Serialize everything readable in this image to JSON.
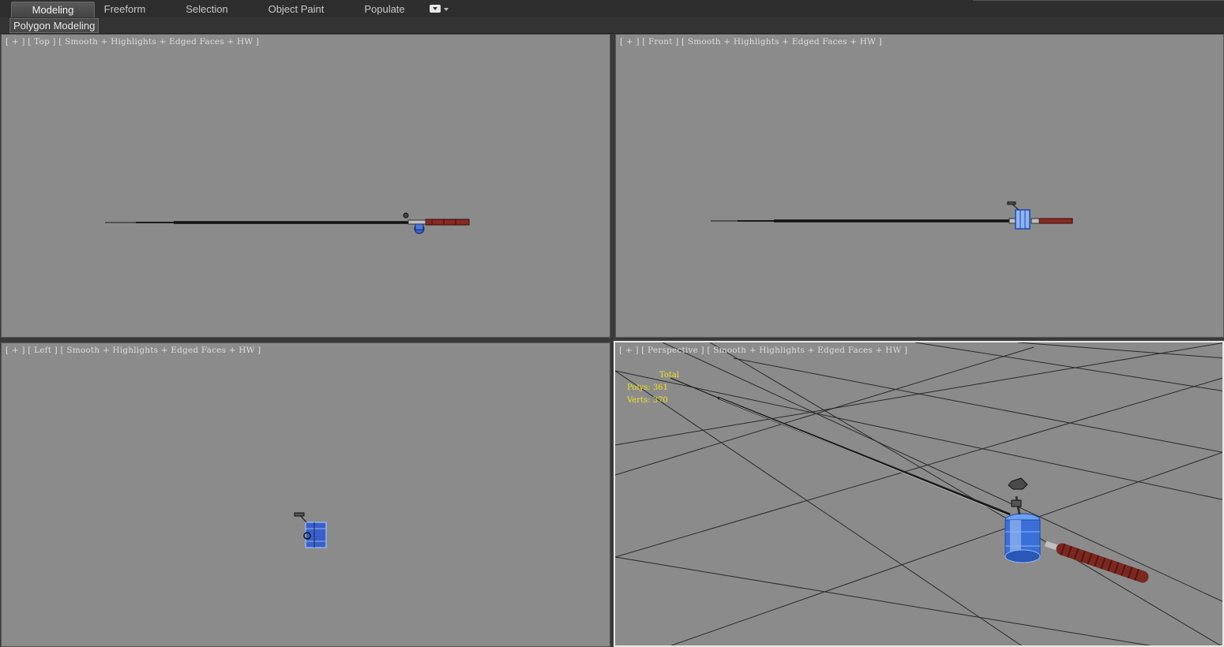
{
  "ribbon": {
    "tabs": [
      {
        "label": "Modeling"
      },
      {
        "label": "Freeform"
      },
      {
        "label": "Selection"
      },
      {
        "label": "Object Paint"
      },
      {
        "label": "Populate"
      }
    ],
    "panel_label": "Polygon Modeling"
  },
  "viewports": {
    "top": {
      "plus": "[ + ]",
      "view": "[ Top ]",
      "shading": "[ Smooth + Highlights + Edged Faces + HW ]"
    },
    "front": {
      "plus": "[ + ]",
      "view": "[ Front ]",
      "shading": "[ Smooth + Highlights + Edged Faces + HW ]"
    },
    "left": {
      "plus": "[ + ]",
      "view": "[ Left ]",
      "shading": "[ Smooth + Highlights + Edged Faces + HW ]"
    },
    "perspective": {
      "plus": "[ + ]",
      "view": "[ Perspective ]",
      "shading": "[ Smooth + Highlights + Edged Faces + HW ]",
      "stats": {
        "heading": "Total",
        "polys": "Polys: 361",
        "verts": "Verts: 370"
      }
    }
  },
  "colors": {
    "viewport_bg": "#8b8b8b",
    "reel_blue": "#3a6fd8",
    "handle_red": "#8a2a22",
    "stats_yellow": "#f1e21a"
  }
}
